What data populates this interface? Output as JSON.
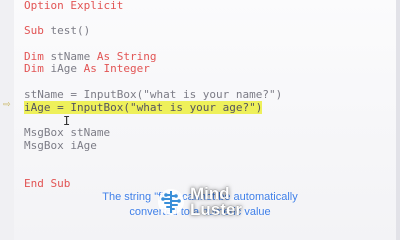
{
  "code_lines": [
    {
      "kw": "Option Explicit",
      "text": ""
    },
    {
      "kw": "",
      "text": ""
    },
    {
      "kw": "Sub ",
      "text": "test()"
    },
    {
      "kw": "",
      "text": ""
    },
    {
      "kw": "Dim ",
      "text": "stName ",
      "kw2": "As String"
    },
    {
      "kw": "Dim ",
      "text": "iAge ",
      "kw2": "As Integer"
    },
    {
      "kw": "",
      "text": ""
    },
    {
      "kw": "",
      "text": "stName = InputBox(\"what is your name?\")"
    },
    {
      "kw": "",
      "text": "iAge = InputBox(\"what is your age?\")",
      "highlight": true
    },
    {
      "kw": "",
      "text": ""
    },
    {
      "kw": "",
      "text": "MsgBox stName"
    },
    {
      "kw": "",
      "text": "MsgBox iAge"
    },
    {
      "kw": "",
      "text": ""
    },
    {
      "kw": "",
      "text": ""
    },
    {
      "kw": "End Sub",
      "text": ""
    }
  ],
  "subtitle": {
    "line1": "The string \"fifty\" cannot be automatically",
    "line2": "converted to a numeric value"
  },
  "logo": {
    "line1": "Mind",
    "line2": "Luster"
  },
  "colors": {
    "keyword": "#e25454",
    "highlight": "#eef05a",
    "subtitle": "#3f7fe8"
  }
}
